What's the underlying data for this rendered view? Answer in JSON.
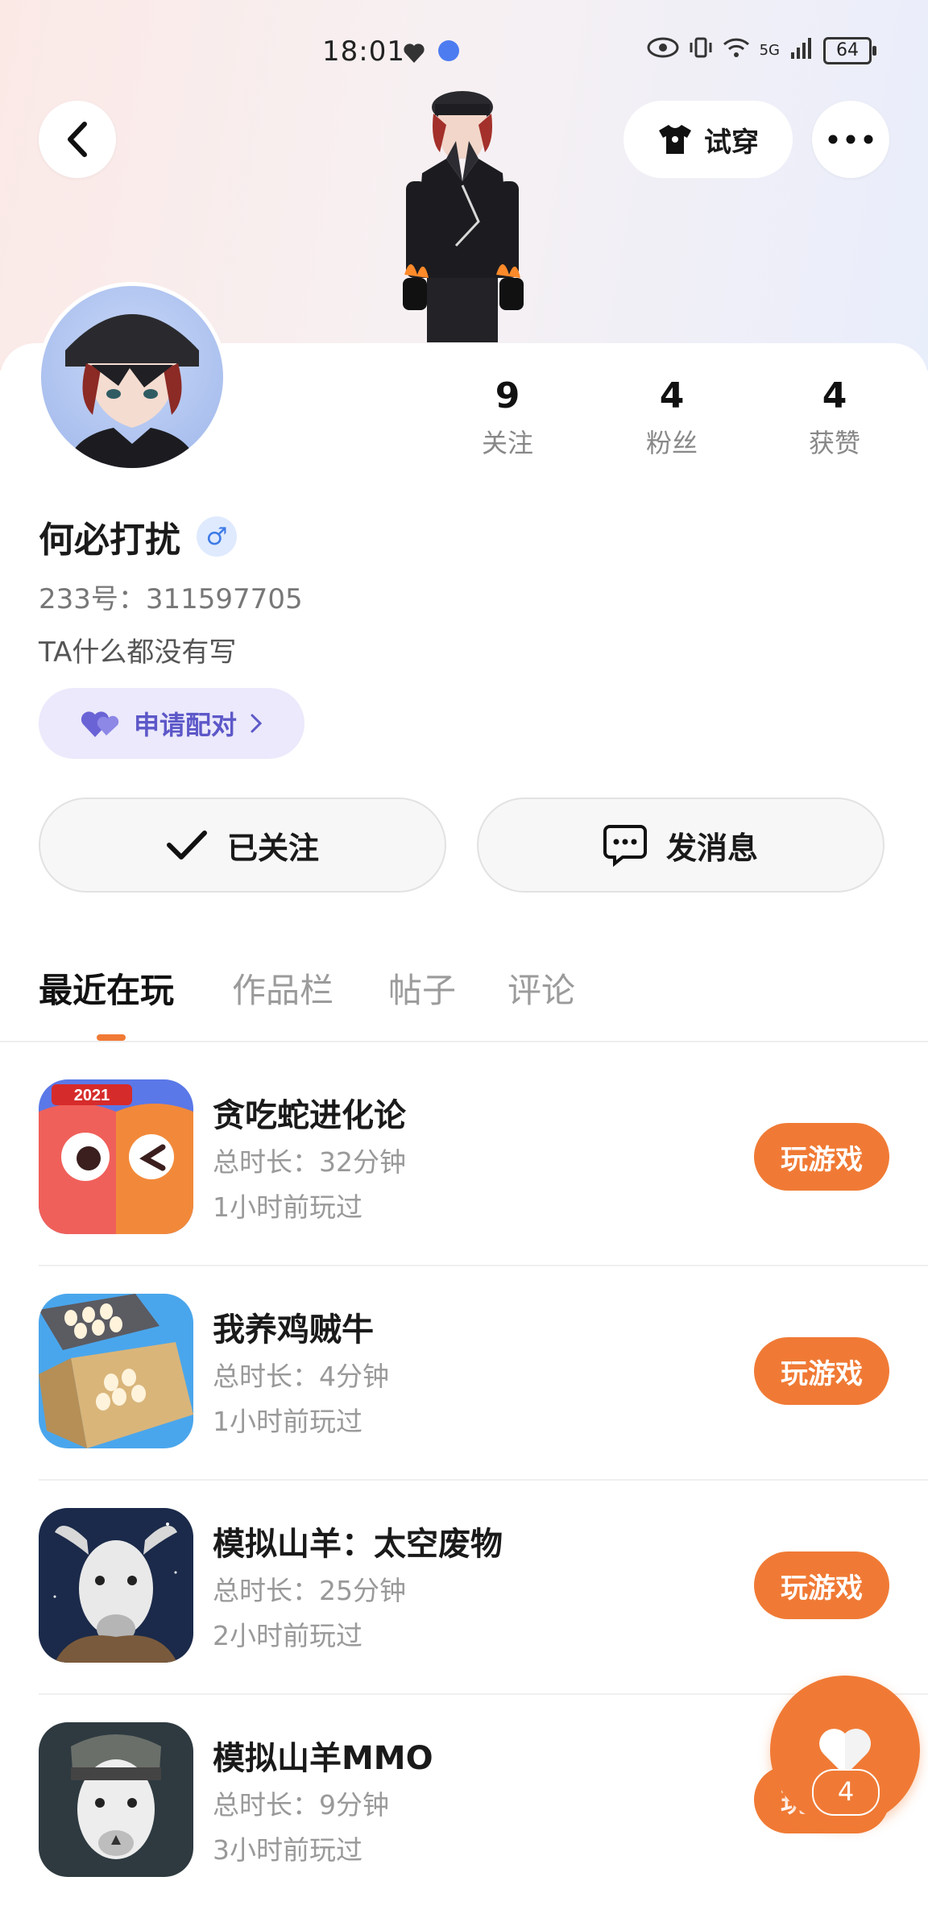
{
  "status_bar": {
    "time": "18:01",
    "network_label": "5G",
    "battery": "64"
  },
  "header": {
    "tryon_label": "试穿"
  },
  "profile": {
    "name": "何必打扰",
    "gender_symbol": "♂",
    "uid_text": "233号：311597705",
    "bio": "TA什么都没有写",
    "pair_label": "申请配对",
    "stats": [
      {
        "value": "9",
        "label": "关注"
      },
      {
        "value": "4",
        "label": "粉丝"
      },
      {
        "value": "4",
        "label": "获赞"
      }
    ]
  },
  "actions": {
    "follow_label": "已关注",
    "message_label": "发消息"
  },
  "tabs": [
    "最近在玩",
    "作品栏",
    "帖子",
    "评论"
  ],
  "games": [
    {
      "name": "贪吃蛇进化论",
      "duration": "总时长：32分钟",
      "last_played": "1小时前玩过",
      "button": "玩游戏",
      "icon": "snake-game-icon",
      "badge": "2021"
    },
    {
      "name": "我养鸡贼牛",
      "duration": "总时长：4分钟",
      "last_played": "1小时前玩过",
      "button": "玩游戏",
      "icon": "egg-factory-icon"
    },
    {
      "name": "模拟山羊：太空废物",
      "duration": "总时长：25分钟",
      "last_played": "2小时前玩过",
      "button": "玩游戏",
      "icon": "goat-space-icon"
    },
    {
      "name": "模拟山羊MMO",
      "duration": "总时长：9分钟",
      "last_played": "3小时前玩过",
      "button": "玩游戏",
      "icon": "goat-mmo-icon"
    }
  ],
  "fab": {
    "count": "4"
  },
  "colors": {
    "accent": "#f07a35",
    "pair_purple": "#5d58c8",
    "gender_blue": "#3e7be6"
  }
}
